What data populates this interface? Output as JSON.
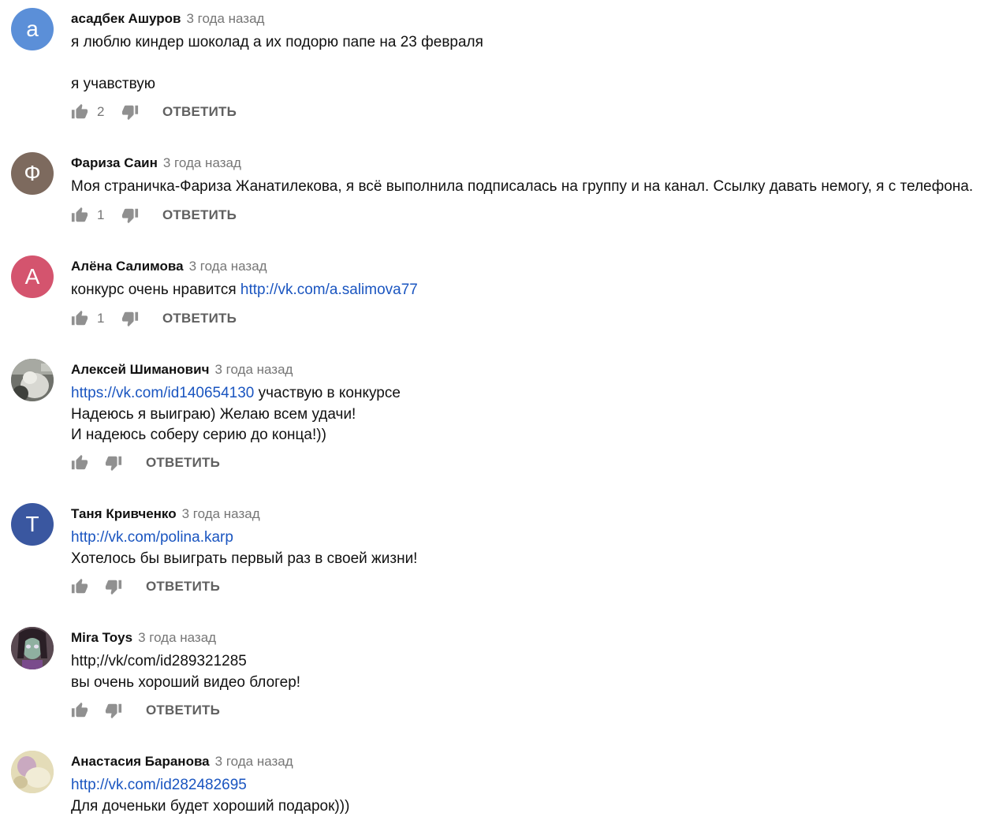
{
  "comments": [
    {
      "author": "асадбек Ашуров",
      "time": "3 года назад",
      "avatar_letter": "а",
      "avatar_color": "#5b8fd8",
      "lines": [
        "я люблю киндер шоколад а их подорю папе на 23 февраля",
        "",
        "я учавствую"
      ],
      "likes": "2",
      "reply_label": "ОТВЕТИТЬ"
    },
    {
      "author": "Фариза Саин",
      "time": "3 года назад",
      "avatar_letter": "Ф",
      "avatar_color": "#7d6a5e",
      "lines": [
        "Моя страничка-Фариза Жанатилекова, я всё выполнила подписалась на группу и на канал. Ссылку давать немогу, я с телефона."
      ],
      "likes": "1",
      "reply_label": "ОТВЕТИТЬ"
    },
    {
      "author": "Алёна Салимова",
      "time": "3 года назад",
      "avatar_letter": "А",
      "avatar_color": "#d4546e",
      "line_text": "конкурс очень нравится ",
      "line_link": "http://vk.com/a.salimova77",
      "likes": "1",
      "reply_label": "ОТВЕТИТЬ"
    },
    {
      "author": "Алексей Шиманович",
      "time": "3 года назад",
      "avatar_image": "photo-avatar-cat",
      "line1_link": "https://vk.com/id140654130",
      "line1_text": " участвую в конкурсе",
      "line2": "Надеюсь я выиграю) Желаю всем удачи!",
      "line3": "И надеюсь соберу серию до конца!))",
      "reply_label": "ОТВЕТИТЬ"
    },
    {
      "author": "Таня Кривченко",
      "time": "3 года назад",
      "avatar_letter": "Т",
      "avatar_color": "#3a57a0",
      "line1_link": "http://vk.com/polina.karp",
      "line2": "Хотелось бы выиграть первый раз в своей жизни!",
      "reply_label": "ОТВЕТИТЬ"
    },
    {
      "author": "Mira Toys",
      "time": "3 года назад",
      "avatar_image": "photo-avatar-doll",
      "line1": "http;//vk/com/id289321285",
      "line2": "вы очень хороший видео блогер!",
      "reply_label": "ОТВЕТИТЬ"
    },
    {
      "author": "Анастасия Баранова",
      "time": "3 года назад",
      "avatar_image": "photo-avatar-toy",
      "line1_link": "http://vk.com/id282482695",
      "line2": "Для доченьки будет хороший подарок)))"
    }
  ]
}
